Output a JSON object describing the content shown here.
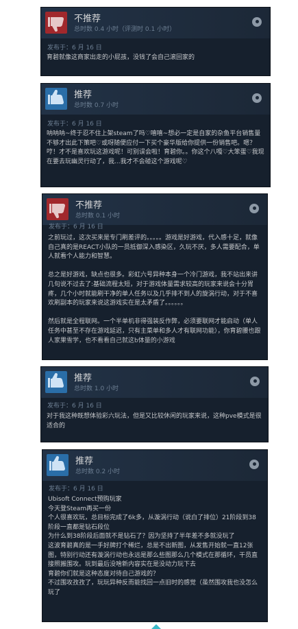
{
  "reviews": [
    {
      "verdict": "不推荐",
      "recommended": false,
      "hours": "总时数 0.4 小时（评测时 0.1 小时）",
      "posted": "发布于：6 月 16 日",
      "paragraphs": [
        "育碧就像这商家出走的小屁孩，没钱了会自己滚回家的"
      ]
    },
    {
      "verdict": "推荐",
      "recommended": true,
      "hours": "总时数 0.7 小时",
      "posted": "发布于：6 月 16 日",
      "paragraphs": [
        "呐呐呐~终于忍不住上架steam了吗♡嘻嘻~想必一定是自家的杂鱼平台销售量不够才出此下策吧♡或呀随便应付一下买个豪华版给你提供一份销售吧。嗯？哼！才不是喜欢玩这游戏呢！可别误会啦！育碧你。。你这个八嘎♡大笨蛋♡我现在要去玩幽灵行动了，我...我才不会碰这个游戏呢♡"
      ]
    },
    {
      "verdict": "不推荐",
      "recommended": false,
      "hours": "总时数 0.1 小时",
      "posted": "发布于：6 月 16 日",
      "paragraphs": [
        "之前玩过，这次买来是专门刷差评的。。。。。游戏是好游戏，代入感十足，就像自己真的是REACT小队的一员抵御深入感染区，久玩不厌，多人需要配合，单人就看个人能力和智慧。",
        "总之是好游戏，缺点也很多。彩虹六号异种本身一个冷门游戏，我不站出来讲几句说不过去了:基础流程太短，对于游戏体量需求较高的玩家来说会十分胃疼，几个小时就能刷干净的单人任务以及几乎排不到人的旋涡行动，对于不喜欢刷副本的玩家来说这游戏实在是太矛盾了。。。。。。",
        "然后就是全程联网。一个半单机非得强装反作弊，必须要联网才能启动（单人任务中甚至不存在游戏延迟，只有主菜单和多人才有联网功能），你育碧腰也跟人家果雪学，也不看看自己就这b体量的小游戏"
      ]
    },
    {
      "verdict": "推荐",
      "recommended": true,
      "hours": "总时数 1.0 小时",
      "posted": "发布于：6 月 16 日",
      "paragraphs": [
        "对于我这种既想体验彩六玩法，但是又比较休闲的玩家来说，这种pve模式是很适合的"
      ]
    },
    {
      "verdict": "推荐",
      "recommended": true,
      "hours": "总时数 0.2 小时",
      "posted": "发布于：6 月 16 日",
      "lines": [
        "Ubisoft Connect预购玩家",
        "今天登Steam再买一份",
        "个人很喜欢玩，总目标完成了6k多，从漩涡行动（说白了排位）21阶段到38阶段一直都是钻石段位",
        "为什么到38阶段后面就不是钻石了？因为坚持了半年差不多就没玩了",
        "这波育碧真的是一手好牌打个稀烂，总是不出新图，从发售开始就一直12张图，特别行动还有漩涡行动也永远是那么些图那么几个模式在那循环，干员直接照搬围攻。玩到最后没啥新内容实在是没动力玩下去",
        "育碧你们就是这种态度对待自己游戏的？",
        "不过围攻孜孜了，玩玩异种反而能找回一点旧时的感觉（虽然围攻我也没怎么玩了"
      ]
    }
  ]
}
